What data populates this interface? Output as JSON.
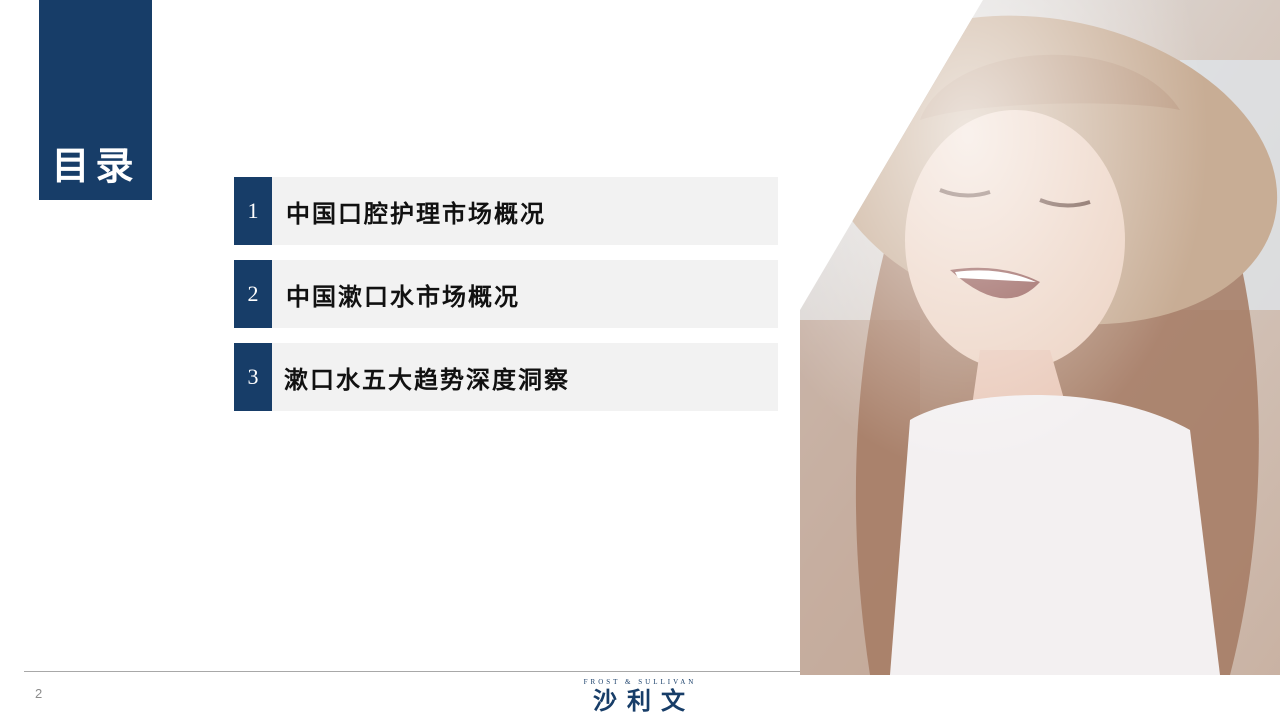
{
  "title": "目录",
  "toc": [
    {
      "num": "1",
      "label": "中国口腔护理市场概况"
    },
    {
      "num": "2",
      "label": "中国漱口水市场概况"
    },
    {
      "num": "3",
      "label": "漱口水五大趋势深度洞察"
    }
  ],
  "footer": {
    "page_number": "2",
    "logo_en": "FROST & SULLIVAN",
    "logo_cn": "沙利文"
  },
  "colors": {
    "brand_navy": "#173d68",
    "item_bg": "#f2f2f2"
  },
  "icons": {
    "photo": "smiling-woman-hat-photo"
  }
}
